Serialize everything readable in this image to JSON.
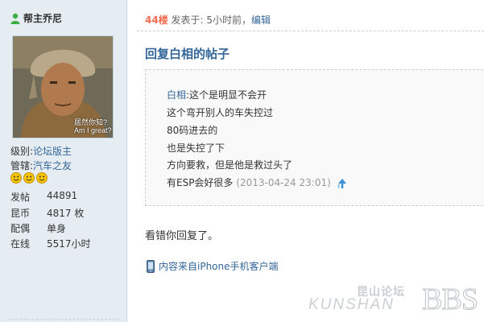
{
  "sidebar": {
    "author": "帮主乔尼",
    "avatar_caption_line1": "居然你知?",
    "avatar_caption_line2": "Am I great?",
    "level_label": "级别:",
    "level_value": "论坛版主",
    "district_label": "管辖:",
    "district_value": "汽车之友",
    "stats": [
      {
        "label": "发帖",
        "value": "44891"
      },
      {
        "label": "昆币",
        "value": "4817 枚"
      },
      {
        "label": "配偶",
        "value": "单身"
      },
      {
        "label": "在线",
        "value": "5517小时"
      }
    ]
  },
  "post": {
    "floor": "44楼",
    "posted": "发表于: 5小时前，",
    "edit": "编辑",
    "title": "回复白相的帖子",
    "quote": {
      "author": "白相",
      "first_line": ":这个是明显不会开",
      "lines": [
        "这个弯开别人的车失控过",
        "80码进去的",
        "也是失控了下",
        "方向要救，但是他是救过头了"
      ],
      "last_line": "有ESP会好很多",
      "time": "(2013-04-24 23:01)"
    },
    "reply": "看错你回复了。",
    "source": "内容来自iPhone手机客户端"
  },
  "watermark": {
    "cn": "昆山论坛",
    "en": "KUNSHAN",
    "bbs": "BBS"
  },
  "colors": {
    "sidebar_bg": "#e5edf2",
    "link": "#336699",
    "floor": "#f26c4f"
  }
}
